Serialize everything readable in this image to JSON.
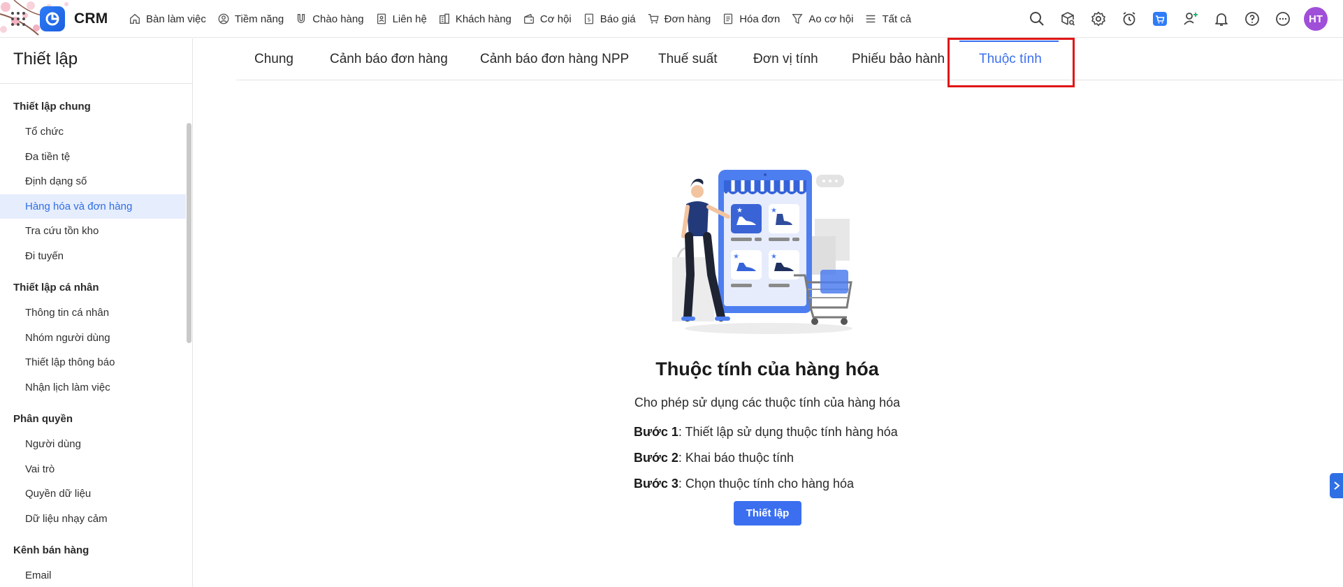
{
  "app": {
    "brand": "CRM"
  },
  "nav": {
    "items": [
      {
        "label": "Bàn làm việc",
        "icon": "home-icon"
      },
      {
        "label": "Tiềm năng",
        "icon": "person-circle-icon"
      },
      {
        "label": "Chào hàng",
        "icon": "magnet-icon"
      },
      {
        "label": "Liên hệ",
        "icon": "contact-card-icon"
      },
      {
        "label": "Khách hàng",
        "icon": "building-icon"
      },
      {
        "label": "Cơ hội",
        "icon": "wallet-icon"
      },
      {
        "label": "Báo giá",
        "icon": "quote-doc-icon"
      },
      {
        "label": "Đơn hàng",
        "icon": "cart-icon"
      },
      {
        "label": "Hóa đơn",
        "icon": "invoice-icon"
      },
      {
        "label": "Ao cơ hội",
        "icon": "funnel-icon"
      },
      {
        "label": "Tất cả",
        "icon": "menu-lines-icon"
      }
    ]
  },
  "header_icons": [
    "search-icon",
    "box-search-icon",
    "gear-icon",
    "alarm-clock-icon",
    "shop-cart-icon",
    "add-user-icon",
    "bell-icon",
    "help-icon",
    "more-icon"
  ],
  "user": {
    "initials": "HT",
    "avatar_color": "#a04fd9"
  },
  "sidebar": {
    "title": "Thiết lập",
    "groups": [
      {
        "label": "Thiết lập chung",
        "items": [
          "Tổ chức",
          "Đa tiền tệ",
          "Định dạng số",
          "Hàng hóa và đơn hàng",
          "Tra cứu tồn kho",
          "Đi tuyến"
        ]
      },
      {
        "label": "Thiết lập cá nhân",
        "items": [
          "Thông tin cá nhân",
          "Nhóm người dùng",
          "Thiết lập thông báo",
          "Nhận lịch làm việc"
        ]
      },
      {
        "label": "Phân quyền",
        "items": [
          "Người dùng",
          "Vai trò",
          "Quyền dữ liệu",
          "Dữ liệu nhạy cảm"
        ]
      },
      {
        "label": "Kênh bán hàng",
        "items": [
          "Email"
        ]
      }
    ],
    "active_item": "Hàng hóa và đơn hàng"
  },
  "tabs": {
    "items": [
      "Chung",
      "Cảnh báo đơn hàng",
      "Cảnh báo đơn hàng NPP",
      "Thuế suất",
      "Đơn vị tính",
      "Phiếu bảo hành",
      "Thuộc tính"
    ],
    "active": "Thuộc tính"
  },
  "empty_state": {
    "title": "Thuộc tính của hàng hóa",
    "description": "Cho phép sử dụng các thuộc tính của hàng hóa",
    "steps": [
      {
        "label": "Bước 1",
        "text": ": Thiết lập sử dụng thuộc tính hàng hóa"
      },
      {
        "label": "Bước 2",
        "text": ": Khai báo thuộc tính"
      },
      {
        "label": "Bước 3",
        "text": ": Chọn thuộc tính cho hàng hóa"
      }
    ],
    "button_label": "Thiết lập"
  },
  "colors": {
    "accent": "#3b6ff0",
    "active_bg": "#e6edfd",
    "highlight": "#e01616"
  }
}
